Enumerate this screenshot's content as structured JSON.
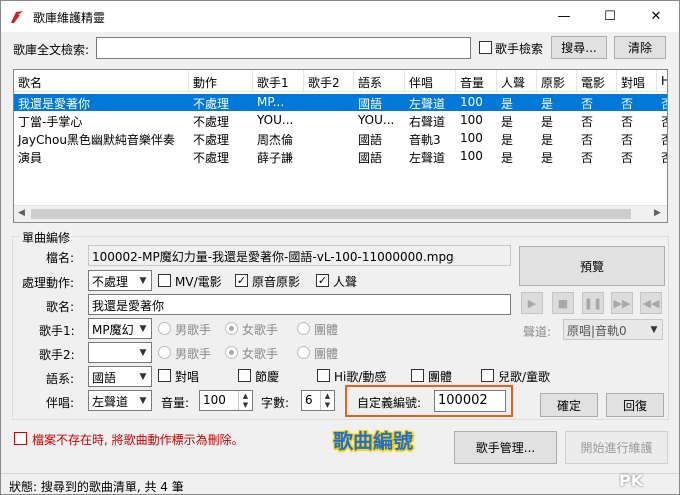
{
  "window": {
    "title": "歌庫維護精靈",
    "minimize": "—",
    "maximize": "☐",
    "close": "✕"
  },
  "search": {
    "label": "歌庫全文檢索:",
    "value": "",
    "singer_search_label": "歌手檢索",
    "search_button": "搜尋...",
    "clear_button": "清除"
  },
  "table": {
    "columns": [
      "歌名",
      "動作",
      "歌手1",
      "歌手2",
      "語系",
      "伴唱",
      "音量",
      "人聲",
      "原影",
      "電影",
      "對唱",
      "H"
    ],
    "rows": [
      [
        "我還是愛著你",
        "不處理",
        "MP...",
        "",
        "國語",
        "左聲道",
        "100",
        "是",
        "是",
        "否",
        "否",
        "否"
      ],
      [
        "丁當-手掌心",
        "不處理",
        "YOU...",
        "",
        "YOU...",
        "右聲道",
        "100",
        "是",
        "是",
        "否",
        "否",
        "否"
      ],
      [
        "JayChou黑色幽默純音樂伴奏",
        "不處理",
        "周杰倫",
        "",
        "國語",
        "音軌3",
        "100",
        "是",
        "是",
        "否",
        "否",
        "否"
      ],
      [
        "演員",
        "不處理",
        "薛子謙",
        "",
        "國語",
        "左聲道",
        "100",
        "是",
        "是",
        "否",
        "否",
        "否"
      ]
    ]
  },
  "edit": {
    "group_title": "單曲編修",
    "filename_label": "檔名:",
    "filename": "100002-MP魔幻力量-我還是愛著你-國語-vL-100-11000000.mpg",
    "action_label": "處理動作:",
    "action_value": "不處理",
    "mv_label": "MV/電影",
    "original_label": "原音原影",
    "vocal_label": "人聲",
    "song_label": "歌名:",
    "song_value": "我還是愛著你",
    "singer1_label": "歌手1:",
    "singer1_value": "MP魔幻",
    "singer2_label": "歌手2:",
    "singer2_value": "",
    "male_label": "男歌手",
    "female_label": "女歌手",
    "group_label": "團體",
    "language_label": "語系:",
    "language_value": "國語",
    "duet_label": "對唱",
    "festival_label": "節慶",
    "hi_label": "Hi歌/動感",
    "group2_label": "團體",
    "kids_label": "兒歌/童歌",
    "accompany_label": "伴唱:",
    "accompany_value": "左聲道",
    "volume_label": "音量:",
    "volume_value": "100",
    "wordcount_label": "字數:",
    "wordcount_value": "6",
    "custom_id_label": "自定義編號:",
    "custom_id_value": "100002",
    "preview_button": "預覽",
    "track_label": "聲道:",
    "track_value": "原唱|音軌0",
    "confirm_button": "確定",
    "restore_button": "回復"
  },
  "annotation": "歌曲編號",
  "bottom": {
    "delete_missing_label": "檔案不存在時, 將歌曲動作標示為刪除。",
    "singer_manage_button": "歌手管理...",
    "start_button": "開始進行維護"
  },
  "status": {
    "text": "狀態: 搜尋到的歌曲清單, 共 4 筆"
  },
  "watermark": "PK",
  "colors": {
    "accent": "#0078d7",
    "highlight_box": "#e8601c",
    "annotation_text": "#1f6fd8",
    "annotation_outline": "#ffd400",
    "warning": "#cc0000"
  }
}
